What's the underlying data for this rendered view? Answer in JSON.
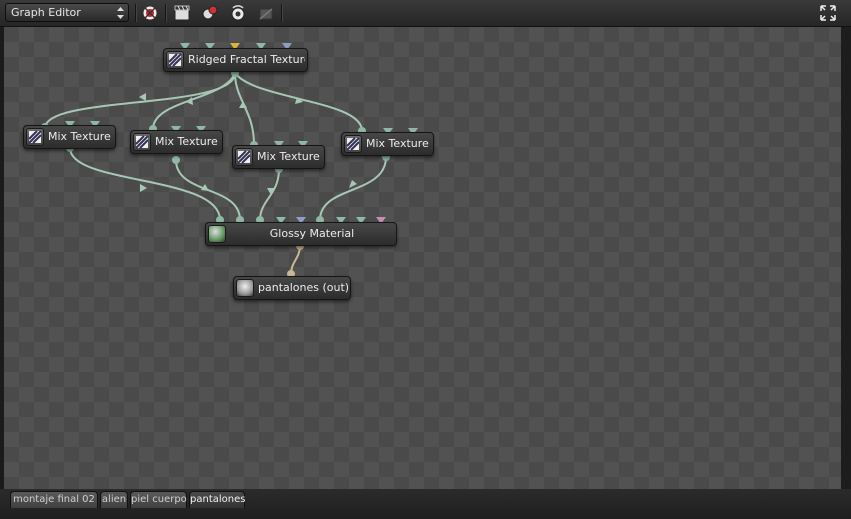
{
  "toolbar": {
    "editor_select": "Graph Editor",
    "icons": [
      "bug-icon",
      "clapper-icon",
      "material-spheres-icon",
      "camera-cycle-icon",
      "camera-disabled-icon",
      "maximize-icon"
    ]
  },
  "nodes": {
    "ridged_fractal": "Ridged Fractal Texture",
    "mix1": "Mix Texture",
    "mix2": "Mix Texture",
    "mix3": "Mix Texture",
    "mix4": "Mix Texture",
    "glossy": "Glossy Material",
    "output": "pantalones (out)"
  },
  "tabs": [
    "montaje final 02",
    "alien",
    "piel cuerpo",
    "pantalones"
  ],
  "active_tab": "pantalones",
  "colors": {
    "wire": "#a7c7b4",
    "wire_mat": "#c8b795",
    "socket_teal": "#8fb9a4",
    "socket_yellow": "#d9b43c",
    "socket_blue": "#8d9dc4",
    "socket_pink": "#c48db8"
  }
}
